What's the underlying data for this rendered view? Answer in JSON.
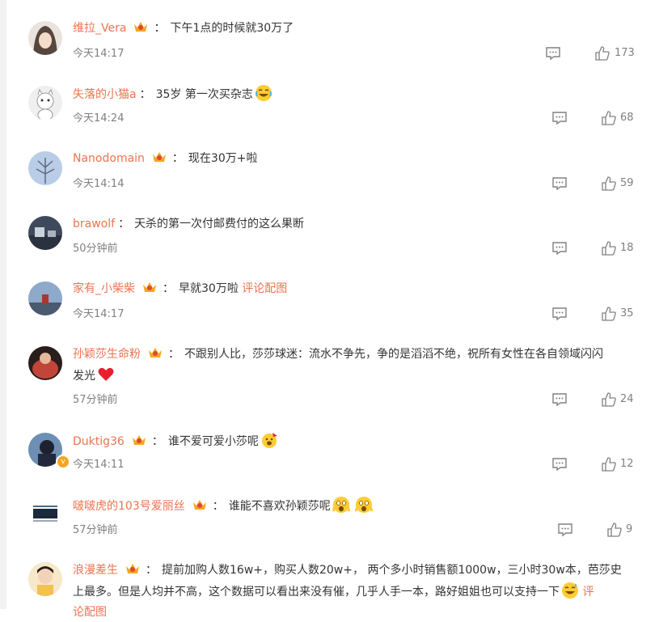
{
  "comments": [
    {
      "user": "维拉_Vera",
      "badge": true,
      "text": "下午1点的时候就30万了",
      "text2": "",
      "link": "",
      "emoji": "",
      "time": "今天14:17",
      "likes": "173"
    },
    {
      "user": "失落的小猫a",
      "badge": false,
      "text": "35岁 第一次买杂志",
      "text2": "",
      "link": "",
      "emoji": "laugh-cry",
      "time": "今天14:24",
      "likes": "68"
    },
    {
      "user": "Nanodomain",
      "badge": true,
      "text": "现在30万+啦",
      "text2": "",
      "link": "",
      "emoji": "",
      "time": "今天14:14",
      "likes": "59"
    },
    {
      "user": "brawolf",
      "badge": false,
      "text": "天杀的第一次付邮费付的这么果断",
      "text2": "",
      "link": "",
      "emoji": "",
      "time": "50分钟前",
      "likes": "18"
    },
    {
      "user": "家有_小柴柴",
      "badge": true,
      "text": "早就30万啦",
      "text2": "",
      "link": "评论配图",
      "emoji": "",
      "time": "今天14:17",
      "likes": "35"
    },
    {
      "user": "孙颖莎生命粉",
      "badge": true,
      "text": "不跟别人比，莎莎球迷：流水不争先，争的是滔滔不绝，祝所有女性在各自领域闪闪",
      "text2": "发光",
      "link": "",
      "emoji": "heart",
      "time": "57分钟前",
      "likes": "24"
    },
    {
      "user": "Duktig36",
      "badge": true,
      "text": "谁不爱可爱小莎呢",
      "text2": "",
      "link": "",
      "emoji": "party",
      "time": "今天14:11",
      "likes": "12"
    },
    {
      "user": "啵啵虎的103号爱丽丝",
      "badge": true,
      "text": "谁能不喜欢孙颖莎呢",
      "text2": "",
      "link": "",
      "emoji": "scream-double",
      "time": "57分钟前",
      "likes": "9"
    },
    {
      "user": "浪漫差生",
      "badge": true,
      "text": "提前加购人数16w+，购买人数20w+， 两个多小时销售额1000w，三小时30w本，芭莎史",
      "text2": "上最多。但是人均并不高，这个数据可以看出来没有催，几乎人手一本，路好姐姐也可以支持一下",
      "link": "评",
      "emoji": "grin-sweat",
      "time": "",
      "likes": ""
    }
  ],
  "labels": {
    "link_tail": "论配图"
  }
}
